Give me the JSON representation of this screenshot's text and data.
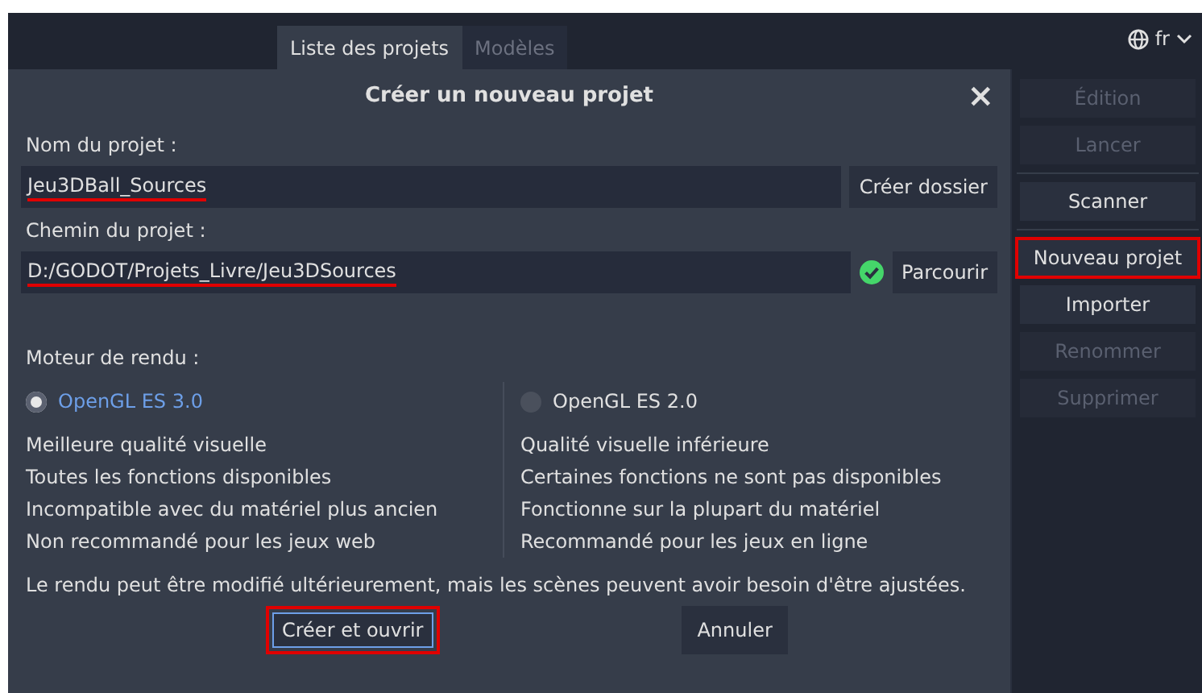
{
  "tabs": [
    {
      "label": "Liste des projets",
      "selected": true
    },
    {
      "label": "Modèles",
      "selected": false
    }
  ],
  "language": {
    "label": "fr"
  },
  "dialog": {
    "title": "Créer un nouveau projet",
    "close": "×",
    "fields": [
      {
        "label": "Nom du projet :",
        "value": "Jeu3DBall_Sources",
        "underlined": true,
        "valid": false,
        "button": "Créer dossier"
      },
      {
        "label": "Chemin du projet :",
        "value": "D:/GODOT/Projets_Livre/Jeu3DSources",
        "underlined": true,
        "valid": true,
        "button": "Parcourir"
      }
    ],
    "renderer_label": "Moteur de rendu :",
    "renderers": [
      {
        "label": "OpenGL ES 3.0",
        "selected": true,
        "lines": [
          "Meilleure qualité visuelle",
          "Toutes les fonctions disponibles",
          "Incompatible avec du matériel plus ancien",
          "Non recommandé pour les jeux web"
        ]
      },
      {
        "label": "OpenGL ES 2.0",
        "selected": false,
        "lines": [
          "Qualité visuelle inférieure",
          "Certaines fonctions ne sont pas disponibles",
          "Fonctionne sur la plupart du matériel",
          "Recommandé pour les jeux en ligne"
        ]
      }
    ],
    "note": "Le rendu peut être modifié ultérieurement, mais les scènes peuvent avoir besoin d'être ajustées.",
    "buttons": [
      {
        "label": "Créer et ouvrir",
        "highlighted": true
      },
      {
        "label": "Annuler",
        "highlighted": false
      }
    ]
  },
  "sidebar": [
    {
      "label": "Édition",
      "disabled": true,
      "highlighted": false,
      "separator_after": false
    },
    {
      "label": "Lancer",
      "disabled": true,
      "highlighted": false,
      "separator_after": true
    },
    {
      "label": "Scanner",
      "disabled": false,
      "highlighted": false,
      "separator_after": true
    },
    {
      "label": "Nouveau projet",
      "disabled": false,
      "highlighted": true,
      "separator_after": false
    },
    {
      "label": "Importer",
      "disabled": false,
      "highlighted": false,
      "separator_after": false
    },
    {
      "label": "Renommer",
      "disabled": true,
      "highlighted": false,
      "separator_after": false
    },
    {
      "label": "Supprimer",
      "disabled": true,
      "highlighted": false,
      "separator_after": false
    }
  ]
}
